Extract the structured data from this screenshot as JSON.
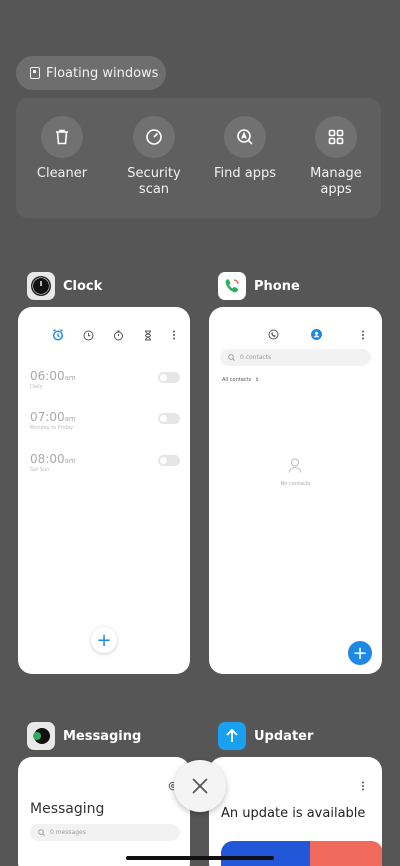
{
  "floating": {
    "label": "Floating windows"
  },
  "tools": [
    {
      "label": "Cleaner",
      "icon": "trash-icon"
    },
    {
      "label": "Security\nscan",
      "icon": "security-scan-icon"
    },
    {
      "label": "Find apps",
      "icon": "find-apps-icon"
    },
    {
      "label": "Manage\napps",
      "icon": "manage-apps-icon"
    }
  ],
  "apps": {
    "clock": {
      "name": "Clock",
      "alarms": [
        {
          "time": "06:00",
          "ampm": "am",
          "repeat": "Daily"
        },
        {
          "time": "07:00",
          "ampm": "am",
          "repeat": "Monday to Friday"
        },
        {
          "time": "08:00",
          "ampm": "am",
          "repeat": "Sat Sun"
        }
      ]
    },
    "phone": {
      "name": "Phone",
      "search_placeholder": "0 contacts",
      "filter": "All contacts",
      "empty_text": "No contacts"
    },
    "messaging": {
      "name": "Messaging",
      "title": "Messaging",
      "search_placeholder": "0 messages"
    },
    "updater": {
      "name": "Updater",
      "title": "An update is available"
    }
  },
  "colors": {
    "accent": "#1e88e5",
    "background": "#565656"
  }
}
